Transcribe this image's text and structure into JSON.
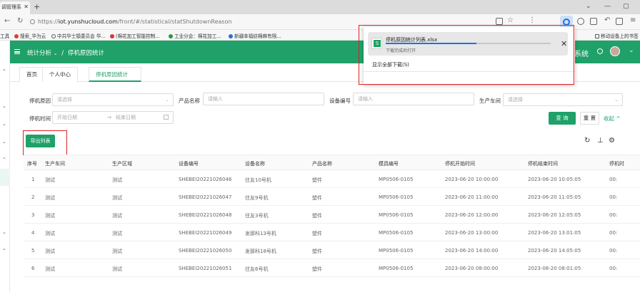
{
  "browser": {
    "tab_title": "调管理系",
    "url_prefix": "https://",
    "url_domain": "iot.yunshucloud.com",
    "url_path": "/front/#/statistical/statShutdownReason",
    "bookmarks": [
      "工具",
      "搜索_华为云",
      "中共华士镇委员会 华...",
      "(棉花加工智能控制...",
      "工业分会：棉花加工...",
      "新疆幸福纺棉麻有限...",
      "移动设备上的书签"
    ]
  },
  "download": {
    "filename": "停机原因统计列表.xlsx",
    "status": "下载完成后打开",
    "progress": 0.55,
    "show_all": "显示全部下载(S)"
  },
  "header": {
    "breadcrumb_parent": "统计分析",
    "breadcrumb_sep": "/",
    "breadcrumb_current": "停机原因统计",
    "system_suffix": "系统"
  },
  "page_tabs": [
    "首页",
    "个人中心",
    "停机原因统计"
  ],
  "filters": {
    "reason_label": "停机原因",
    "reason_ph": "请选择",
    "product_label": "产品名称",
    "product_ph": "请输入",
    "device_label": "设备编号",
    "device_ph": "请输入",
    "workshop_label": "生产车间",
    "workshop_ph": "请选择",
    "time_label": "停机时间",
    "start_ph": "开始日期",
    "range_sep": "→",
    "end_ph": "结束日期",
    "query_btn": "查 询",
    "reset_btn": "重 置",
    "collapse": "收起 ^"
  },
  "toolbar": {
    "export_btn": "导出列表"
  },
  "table": {
    "headers": [
      "序号",
      "生产车间",
      "生产区域",
      "设备编号",
      "设备名称",
      "产品名称",
      "模具编号",
      "停机开始时间",
      "停机结束时间",
      "停机时"
    ],
    "rows": [
      [
        "1",
        "测试",
        "测试",
        "SHEBEI20221026046",
        "往友10号机",
        "塑件",
        "MP0506-0105",
        "2023-06-20 10:00:00",
        "2023-06-20 10:05:05",
        "00:"
      ],
      [
        "2",
        "测试",
        "测试",
        "SHEBEI20221026047",
        "往友9号机",
        "塑件",
        "MP0506-0105",
        "2023-06-20 11:00:00",
        "2023-06-20 11:05:05",
        "00:"
      ],
      [
        "3",
        "测试",
        "测试",
        "SHEBEI20221026048",
        "往友3号机",
        "塑件",
        "MP0506-0105",
        "2023-06-20 12:00:00",
        "2023-06-20 12:05:05",
        "00:"
      ],
      [
        "4",
        "测试",
        "测试",
        "SHEBEI20221026049",
        "发那科13号机",
        "塑件",
        "MP0506-0105",
        "2023-06-20 13:00:00",
        "2023-06-20 13:01:05",
        "00:"
      ],
      [
        "5",
        "测试",
        "测试",
        "SHEBEI20221026050",
        "发那科18号机",
        "塑件",
        "MP0506-0105",
        "2023-06-20 14:00:00",
        "2023-06-20 14:05:05",
        "00:"
      ],
      [
        "6",
        "测试",
        "测试",
        "SHEBEI20221026051",
        "往友6号机",
        "塑件",
        "MP0506-0105",
        "2023-06-20 08:00:00",
        "2023-06-20 08:01:05",
        "00:"
      ]
    ]
  },
  "colors": {
    "brand": "#1fa169",
    "highlight": "#e02020",
    "download_blue": "#1a73e8"
  }
}
